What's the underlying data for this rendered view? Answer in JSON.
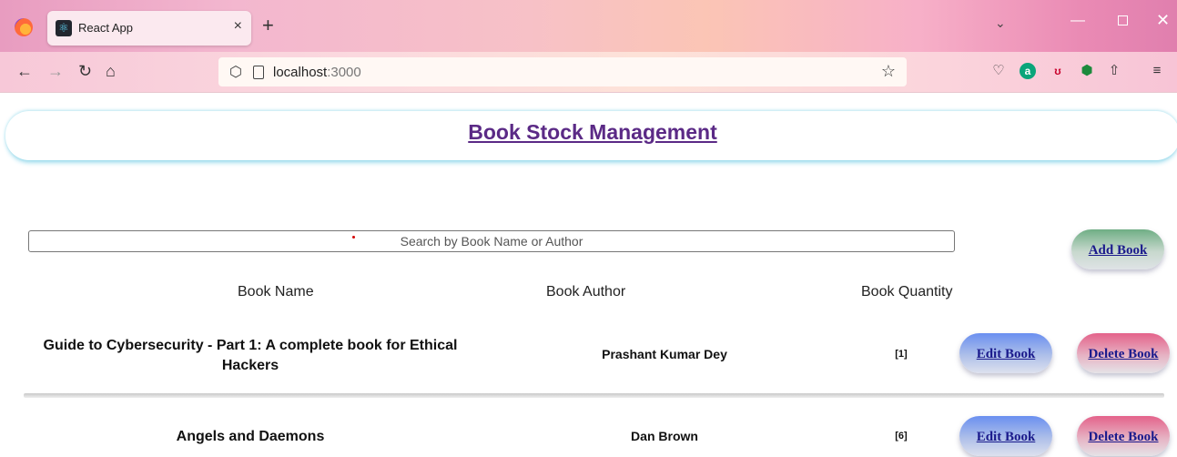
{
  "browser": {
    "tab_title": "React App",
    "tab_close": "×",
    "new_tab": "+",
    "url_host": "localhost",
    "url_port": ":3000"
  },
  "page": {
    "title": "Book Stock Management",
    "search_placeholder": "Search by Book Name or Author",
    "add_label": "Add Book",
    "columns": [
      "Book Name",
      "Book Author",
      "Book Quantity"
    ],
    "edit_label": "Edit Book",
    "delete_label": "Delete Book",
    "books": [
      {
        "name_line1": "Guide to Cybersecurity - Part 1: A complete book for Ethical",
        "name_line2": "Hackers",
        "author": "Prashant Kumar Dey",
        "quantity": "[1]"
      },
      {
        "name_line1": "Angels and Daemons",
        "name_line2": "",
        "author": "Dan Brown",
        "quantity": "[6]"
      }
    ]
  },
  "colors": {
    "title": "#5b2a86",
    "button_text": "#1a1a8c",
    "header_glow": "#86d3e8"
  },
  "icons": [
    "firefox-icon",
    "react-icon",
    "back-icon",
    "forward-icon",
    "reload-icon",
    "home-icon",
    "shield-icon",
    "page-icon",
    "star-icon",
    "pocket-icon",
    "extension-a-icon",
    "extension-u-icon",
    "vpn-shield-icon",
    "share-icon",
    "menu-icon",
    "chevron-down-icon",
    "minimize-icon",
    "maximize-icon",
    "close-icon"
  ]
}
